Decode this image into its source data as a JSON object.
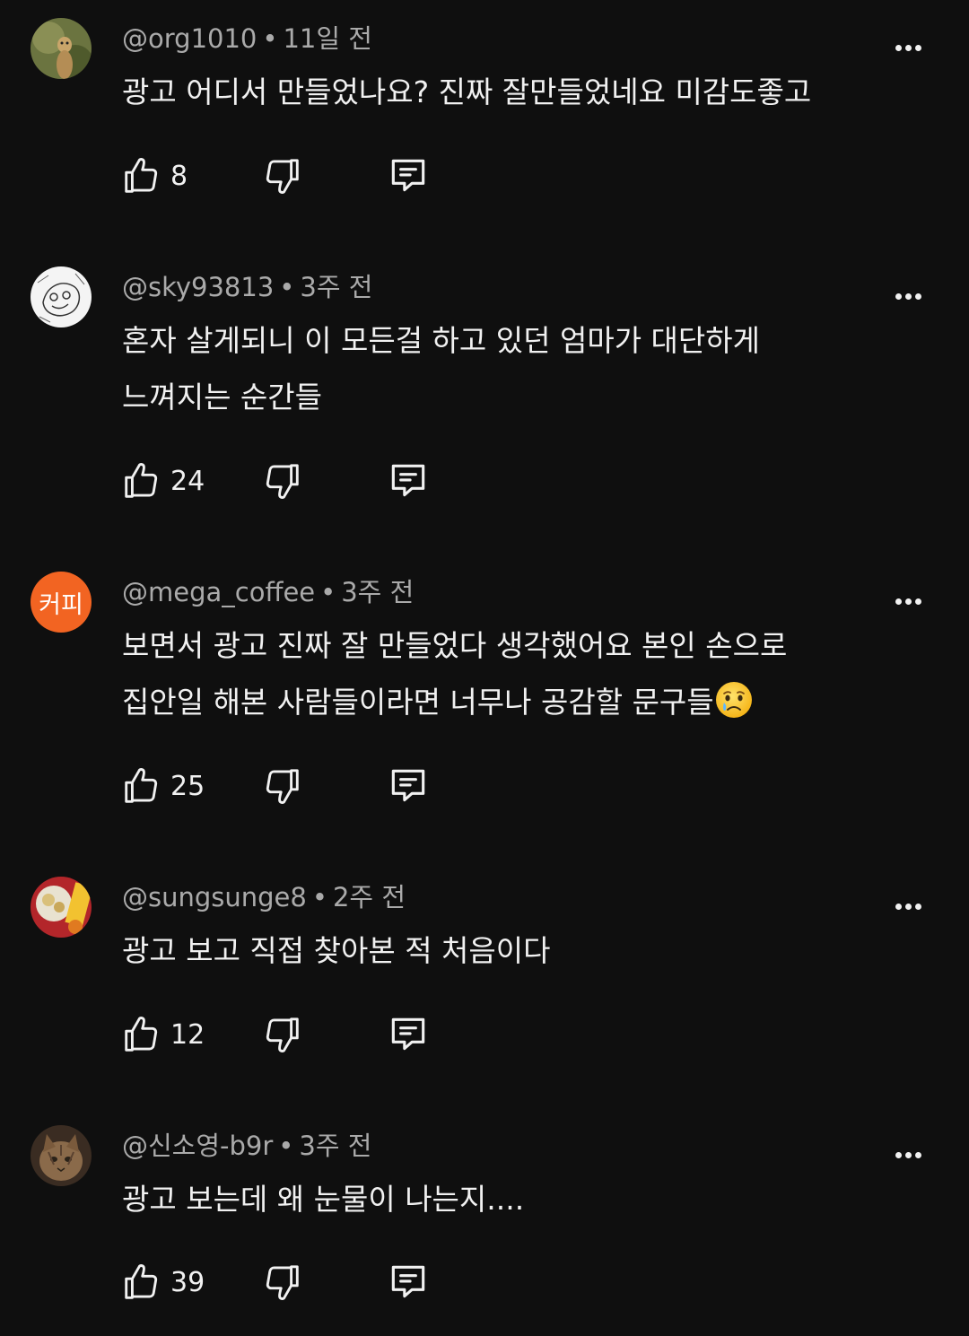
{
  "comments": [
    {
      "author": "@org1010",
      "time": "11일 전",
      "lines": [
        "광고 어디서 만들었나요? 진짜 잘만들었네요 미감도좋고"
      ],
      "likes": "8",
      "avatar": "meerkat-photo"
    },
    {
      "author": "@sky93813",
      "time": "3주 전",
      "lines": [
        "혼자 살게되니 이 모든걸 하고 있던 엄마가 대단하게",
        "느껴지는 순간들"
      ],
      "likes": "24",
      "avatar": "sketch-drawing"
    },
    {
      "author": "@mega_coffee",
      "time": "3주 전",
      "lines": [
        "보면서 광고 진짜 잘 만들었다 생각했어요 본인 손으로",
        "집안일 해본 사람들이라면 너무나 공감할 문구들"
      ],
      "emoji": "crying-face",
      "likes": "25",
      "avatar_text": "커피",
      "avatar_color": "#f26422"
    },
    {
      "author": "@sungsunge8",
      "time": "2주 전",
      "lines": [
        "광고 보고 직접 찾아본 적 처음이다"
      ],
      "likes": "12",
      "avatar": "food-photo"
    },
    {
      "author": "@신소영-b9r",
      "time": "3주 전",
      "lines": [
        "광고 보는데 왜 눈물이 나는지...."
      ],
      "likes": "39",
      "avatar": "cat-photo"
    }
  ],
  "separator": "•",
  "icons": {
    "like": "thumbs-up-icon",
    "dislike": "thumbs-down-icon",
    "reply": "comment-icon",
    "more": "more-horizontal-icon"
  },
  "colors": {
    "background": "#0f0f0f",
    "text": "#f1f1f1",
    "meta": "#aaaaaa",
    "brand_avatar": "#f26422"
  }
}
